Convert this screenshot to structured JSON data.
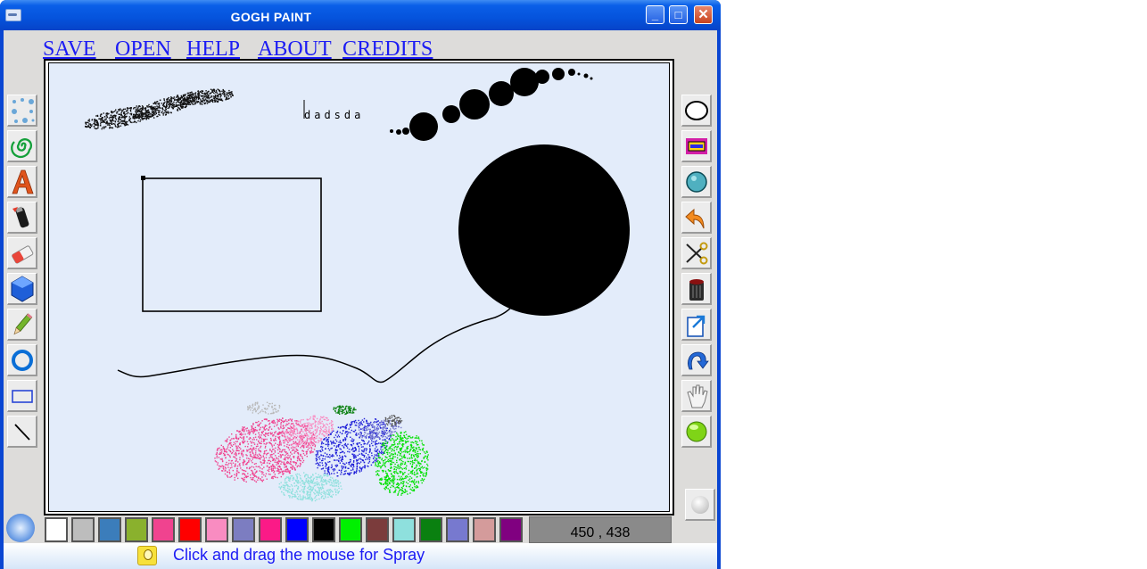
{
  "window": {
    "title": "GOGH PAINT",
    "minimize_label": "_",
    "maximize_label": "□",
    "close_label": "✕"
  },
  "menu": {
    "items": [
      "SAVE",
      "OPEN",
      "HELP",
      "ABOUT",
      "CREDITS"
    ]
  },
  "canvas": {
    "text_sample": "dadsda"
  },
  "left_tools": [
    {
      "name": "spray-tool",
      "icon": "spray-icon"
    },
    {
      "name": "spiral-tool",
      "icon": "spiral-icon"
    },
    {
      "name": "text-tool",
      "icon": "text-a-icon"
    },
    {
      "name": "brush-tool",
      "icon": "marker-icon"
    },
    {
      "name": "eraser-tool",
      "icon": "eraser-icon"
    },
    {
      "name": "polygon-tool",
      "icon": "hexagon-icon"
    },
    {
      "name": "pencil-tool",
      "icon": "pencil-icon"
    },
    {
      "name": "ring-tool",
      "icon": "ring-icon"
    },
    {
      "name": "rectangle-tool",
      "icon": "rectangle-icon"
    },
    {
      "name": "line-tool",
      "icon": "line-icon"
    }
  ],
  "right_tools": [
    {
      "name": "ellipse-tool",
      "icon": "ellipse-icon"
    },
    {
      "name": "rounded-rect-tool",
      "icon": "rounded-rect-icon"
    },
    {
      "name": "filled-ellipse-tool",
      "icon": "filled-circle-icon"
    },
    {
      "name": "undo-tool",
      "icon": "undo-arrow-icon"
    },
    {
      "name": "cut-tool",
      "icon": "scissors-icon"
    },
    {
      "name": "clear-tool",
      "icon": "trash-can-icon"
    },
    {
      "name": "export-tool",
      "icon": "export-icon"
    },
    {
      "name": "redo-tool",
      "icon": "redo-arrow-icon"
    },
    {
      "name": "pan-tool",
      "icon": "hand-icon"
    },
    {
      "name": "light-tool",
      "icon": "green-light-icon"
    }
  ],
  "palette": {
    "colors": [
      "#ffffff",
      "#bdbdbd",
      "#3b7dbb",
      "#8ab12d",
      "#f0438f",
      "#ff0000",
      "#f98cc1",
      "#7c7dc1",
      "#fb1a87",
      "#0000ff",
      "#000000",
      "#00f000",
      "#7b3c3c",
      "#8ee0dd",
      "#0a8010",
      "#7779cf",
      "#d49b9b",
      "#800080"
    ]
  },
  "status": {
    "coordinates": "450 , 438",
    "message": "Click and drag the mouse for Spray"
  }
}
